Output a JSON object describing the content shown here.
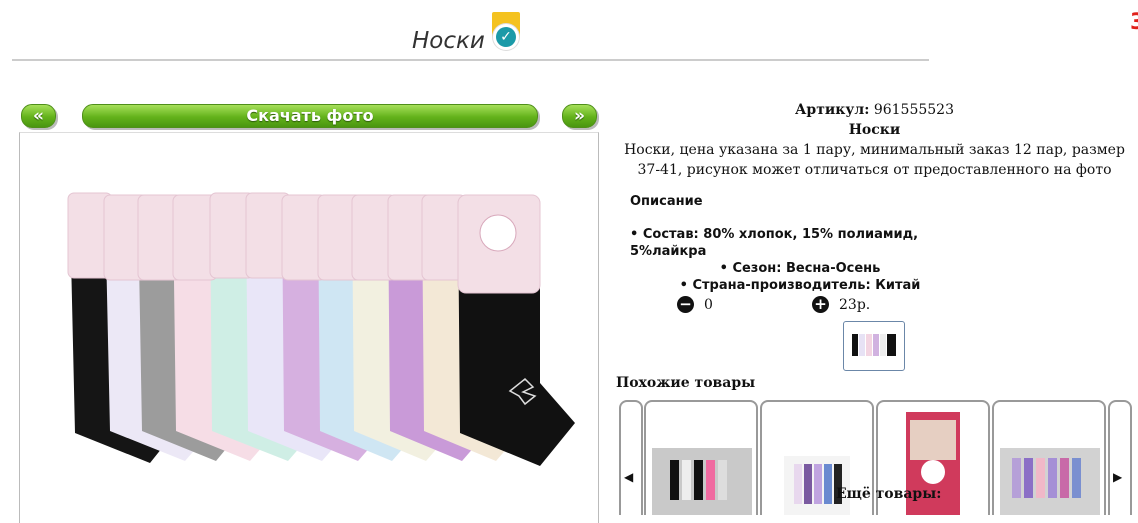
{
  "header": {
    "title": "Носки",
    "badge_icon": "verified-check-icon"
  },
  "nav": {
    "prev_label": "«",
    "download_label": "Скачать фото",
    "next_label": "»"
  },
  "product": {
    "article_label": "Артикул:",
    "article_value": "961555523",
    "name": "Носки",
    "summary": "Носки, цена указана за 1 пару, минимальный заказ 12 пар, размер 37-41, рисунок может отличаться от предоставленного на фото",
    "description_heading": "Описание",
    "specs": [
      "Состав: 80% хлопок, 15% полиамид, 5%лайкра",
      "Сезон: Весна-Осень",
      "Страна-производитель: Китай"
    ],
    "quantity": "0",
    "price": "23р."
  },
  "similar": {
    "title": "Похожие товары"
  },
  "more": {
    "title": "Ещё товары:"
  },
  "colors": {
    "button_green": "#63b21b",
    "badge_yellow": "#f4c21f",
    "badge_teal": "#1b9aa8",
    "links_green": "#1a7a1a"
  }
}
